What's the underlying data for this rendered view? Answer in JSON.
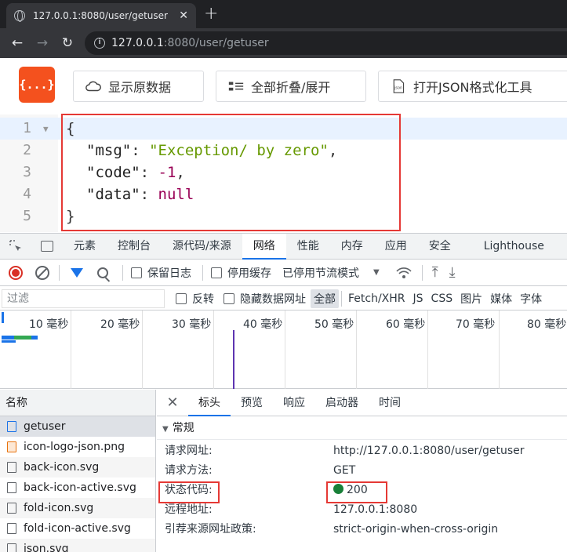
{
  "browser": {
    "tab_title": "127.0.0.1:8080/user/getuser",
    "url_host": "127.0.0.1",
    "url_rest": ":8080/user/getuser"
  },
  "viewer": {
    "logo_text": "{...}",
    "btn_raw": "显示原数据",
    "btn_fold": "全部折叠/展开",
    "btn_open": "打开JSON格式化工具"
  },
  "code": {
    "line_numbers": [
      "1",
      "2",
      "3",
      "4",
      "5"
    ],
    "open_brace": "{",
    "close_brace": "}",
    "msg_key": "\"msg\"",
    "msg_value": "\"Exception/ by zero\"",
    "code_key": "\"code\"",
    "code_value": "-1",
    "data_key": "\"data\"",
    "data_value": "null"
  },
  "devtools": {
    "tabs": [
      "元素",
      "控制台",
      "源代码/来源",
      "网络",
      "性能",
      "内存",
      "应用",
      "安全",
      "Lighthouse"
    ],
    "preserve_log": "保留日志",
    "disable_cache": "停用缓存",
    "throttling": "已停用节流模式",
    "filter_placeholder": "过滤",
    "invert": "反转",
    "hide_data_urls": "隐藏数据网址",
    "filter_types": [
      "全部",
      "Fetch/XHR",
      "JS",
      "CSS",
      "图片",
      "媒体",
      "字体"
    ],
    "timeline_ticks": [
      "10 毫秒",
      "20 毫秒",
      "30 毫秒",
      "40 毫秒",
      "50 毫秒",
      "60 毫秒",
      "70 毫秒",
      "80 毫秒"
    ],
    "names_header": "名称",
    "requests": [
      "getuser",
      "icon-logo-json.png",
      "back-icon.svg",
      "back-icon-active.svg",
      "fold-icon.svg",
      "fold-icon-active.svg",
      "json.svg"
    ],
    "detail_tabs": [
      "标头",
      "预览",
      "响应",
      "启动器",
      "时间"
    ],
    "section_general": "常规",
    "general": {
      "request_url_label": "请求网址:",
      "request_url": "http://127.0.0.1:8080/user/getuser",
      "method_label": "请求方法:",
      "method": "GET",
      "status_label": "状态代码:",
      "status": "200",
      "remote_label": "远程地址:",
      "remote": "127.0.0.1:8080",
      "referrer_label": "引荐来源网址政策:",
      "referrer": "strict-origin-when-cross-origin"
    },
    "colors": {
      "accent": "#1a73e8",
      "status_ok": "#188038",
      "highlight": "#e53935"
    }
  }
}
